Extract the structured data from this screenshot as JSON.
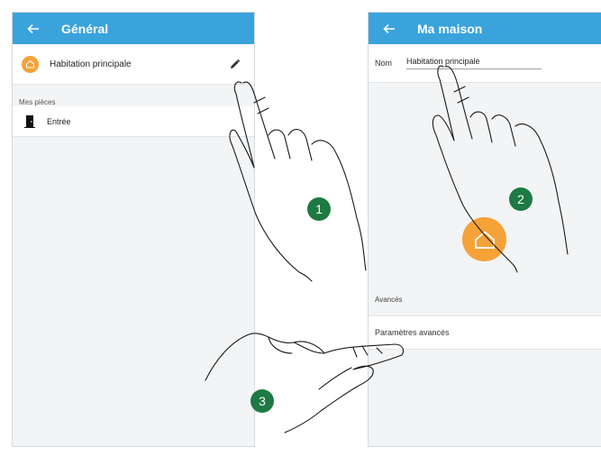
{
  "left_screen": {
    "title": "Général",
    "home_name": "Habitation principale",
    "section_rooms": "Mes pièces",
    "rooms": [
      {
        "label": "Entrée",
        "icon": "door-icon"
      }
    ]
  },
  "right_screen": {
    "title": "Ma maison",
    "name_label": "Nom",
    "name_value": "Habitation principale",
    "section_advanced": "Avancés",
    "advanced_settings": "Paramètres avancés"
  },
  "steps": [
    "1",
    "2",
    "3"
  ],
  "colors": {
    "appbar": "#3aa3dc",
    "accent_orange": "#f5a238",
    "step_badge": "#1d7a42"
  }
}
